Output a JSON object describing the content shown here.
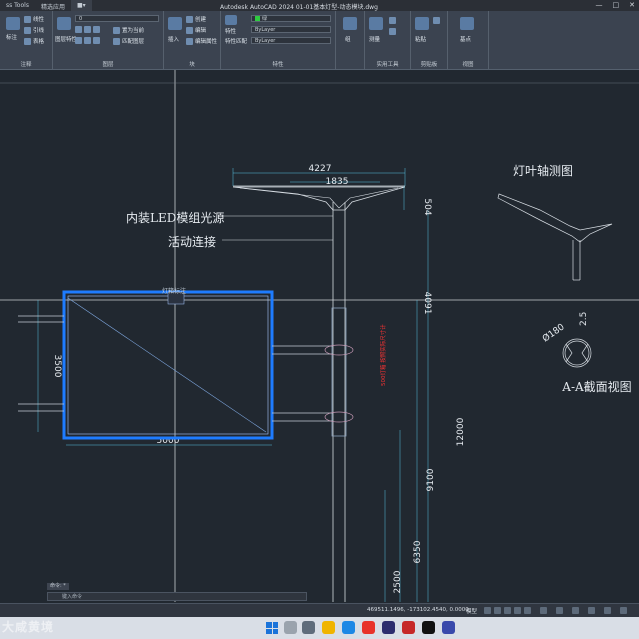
{
  "titlebar": {
    "tab1": "ss Tools",
    "tab2": "精选应用",
    "tab3": "■▾",
    "title": "Autodesk AutoCAD 2024   01-01基本灯型-动态模块.dwg",
    "buttons": [
      "—",
      "□",
      "✕"
    ]
  },
  "ribbon": {
    "draw_label": "绘图",
    "modify_label": "修改",
    "layers_label": "图层",
    "block_label": "块",
    "props_label": "特性",
    "utils_label": "实用工具",
    "clipboard_label": "剪贴板",
    "view_label": "视图",
    "annotate_label": "注释",
    "tools": {
      "line": "线性",
      "leader": "引线",
      "table": "表格",
      "layer_props": "图层特性",
      "current_layer": "0",
      "make_current": "置为当前",
      "match_layer": "匹配图层",
      "insert": "插入",
      "create": "创建",
      "edit": "编辑",
      "edit_attr": "编辑属性",
      "properties": "特性",
      "match": "特性匹配",
      "color": "绿",
      "linetype": "ByLayer",
      "lineweight": "ByLayer",
      "measure": "测量",
      "group": "组",
      "paste": "粘贴",
      "base": "基点",
      "dim": "标注"
    }
  },
  "drawing": {
    "dim_4227": "4227",
    "dim_1835": "1835",
    "dim_504": "504",
    "dim_4091": "4091",
    "dim_12000": "12000",
    "dim_9100": "9100",
    "dim_6350": "6350",
    "dim_2500": "2500",
    "dim_3500": "3500",
    "dim_5000": "5000",
    "dim_phi180": "Ø180",
    "dim_2_5": "2.5",
    "label_led": "内装LED模组光源",
    "label_joint": "活动连接",
    "label_axonometric": "灯叶轴测图",
    "label_section": "A-A截面视图",
    "label_sign_top": "灯箱标注",
    "label_red": "500灯箱 按照实际尺寸计"
  },
  "command": {
    "history": "命令: *",
    "placeholder": "键入命令"
  },
  "status": {
    "coords": "469511.1496, -173102.4540, 0.0000",
    "model": "模型"
  },
  "watermark": "大咸黄境"
}
